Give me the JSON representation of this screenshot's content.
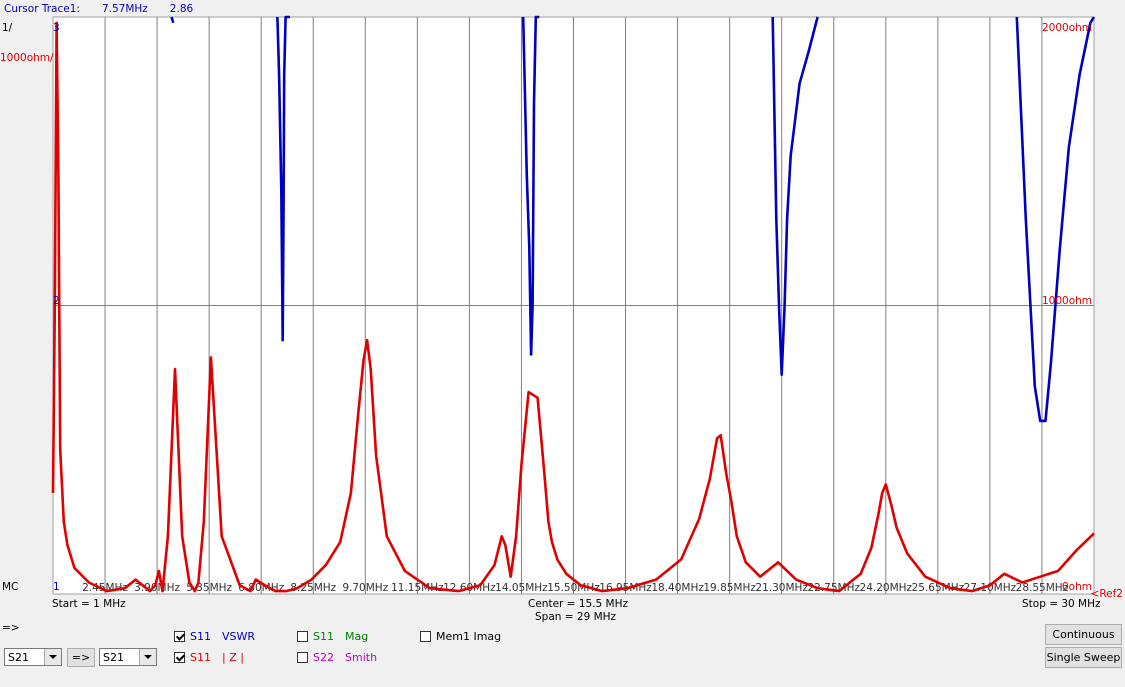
{
  "cursor": {
    "label": "Cursor Trace1:",
    "freq": "7.57MHz",
    "value": "2.86"
  },
  "left_axis": {
    "scale_unit": "1/",
    "scale_ohm": "1000ohm/",
    "top": "3",
    "mid": "2",
    "bottom": "1",
    "mc": "MC"
  },
  "right_axis": {
    "top": "2000ohm",
    "mid": "1000ohm",
    "bottom": "0ohm",
    "ref": "<Ref2"
  },
  "footer": {
    "start": "Start = 1 MHz",
    "center": "Center = 15.5 MHz",
    "span": "Span = 29 MHz",
    "stop": "Stop = 30 MHz",
    "arrow": "=>"
  },
  "controls": {
    "sel1": "S21",
    "transfer": "=>",
    "sel2": "S21",
    "continuous": "Continuous",
    "single_sweep": "Single Sweep",
    "legend": [
      {
        "param": "S11",
        "fmt": "VSWR",
        "checked": true,
        "color": "#0000c0"
      },
      {
        "param": "S11",
        "fmt": "| Z |",
        "checked": true,
        "color": "#e00000"
      },
      {
        "param": "S11",
        "fmt": "Mag",
        "checked": false,
        "color": "#008000"
      },
      {
        "param": "S22",
        "fmt": "Smith",
        "checked": false,
        "color": "#c000c0"
      },
      {
        "param": "",
        "fmt": "Mem1 Imag",
        "checked": false,
        "color": "#000000"
      }
    ]
  },
  "chart_data": {
    "type": "line",
    "x_ticks": [
      "2.45MHz",
      "3.90MHz",
      "5.35MHz",
      "6.80MHz",
      "8.25MHz",
      "9.70MHz",
      "11.15MHz",
      "12.60MHz",
      "14.05MHz",
      "15.50MHz",
      "16.95MHz",
      "18.40MHz",
      "19.85MHz",
      "21.30MHz",
      "22.75MHz",
      "24.20MHz",
      "25.65MHz",
      "27.10MHz",
      "28.55MHz"
    ],
    "xlim": [
      1,
      30
    ],
    "series": [
      {
        "name": "S11 VSWR",
        "color": "#0000c0",
        "axis": "left",
        "ylim": [
          1,
          3
        ],
        "x": [
          4.3,
          4.35,
          7.25,
          7.3,
          7.36,
          7.4,
          7.42,
          7.44,
          7.48,
          7.54,
          7.6,
          14.1,
          14.2,
          14.27,
          14.32,
          14.36,
          14.4,
          14.45,
          14.55,
          21.05,
          21.15,
          21.23,
          21.3,
          21.38,
          21.45,
          21.55,
          21.65,
          21.8,
          22.05,
          22.3,
          27.85,
          28.1,
          28.35,
          28.5,
          28.65,
          28.8,
          29.05,
          29.3,
          29.6,
          29.9,
          30.0
        ],
        "y": [
          3.0,
          2.98,
          3.0,
          2.8,
          2.4,
          1.88,
          2.3,
          2.8,
          3.0,
          3.0,
          3.0,
          3.0,
          2.45,
          2.2,
          1.83,
          2.0,
          2.7,
          3.0,
          3.0,
          3.0,
          2.3,
          1.98,
          1.76,
          2.0,
          2.3,
          2.52,
          2.62,
          2.77,
          2.88,
          3.0,
          3.0,
          2.3,
          1.72,
          1.6,
          1.6,
          1.8,
          2.2,
          2.55,
          2.8,
          2.98,
          3.0
        ]
      },
      {
        "name": "S11 |Z|",
        "color": "#e00000",
        "axis": "right",
        "ylim": [
          0,
          2000
        ],
        "x": [
          1.0,
          1.05,
          1.1,
          1.15,
          1.2,
          1.3,
          1.4,
          1.6,
          2.0,
          2.5,
          3.0,
          3.3,
          3.5,
          3.7,
          3.85,
          3.95,
          4.05,
          4.2,
          4.4,
          4.6,
          4.8,
          4.95,
          5.05,
          5.2,
          5.4,
          5.7,
          6.2,
          6.5,
          6.65,
          6.9,
          7.2,
          7.5,
          7.8,
          8.2,
          8.6,
          9.0,
          9.3,
          9.5,
          9.65,
          9.75,
          9.85,
          10.0,
          10.3,
          10.8,
          11.5,
          12.3,
          12.9,
          13.3,
          13.5,
          13.6,
          13.75,
          13.9,
          14.05,
          14.25,
          14.5,
          14.7,
          14.8,
          14.9,
          15.05,
          15.3,
          15.7,
          16.3,
          17.0,
          17.8,
          18.5,
          19.0,
          19.3,
          19.5,
          19.6,
          19.75,
          19.9,
          20.05,
          20.3,
          20.7,
          21.2,
          21.7,
          22.3,
          22.9,
          23.5,
          23.8,
          24.0,
          24.1,
          24.2,
          24.35,
          24.5,
          24.8,
          25.3,
          26.0,
          26.6,
          27.1,
          27.5,
          28.0,
          28.5,
          29.0,
          29.5,
          30.0
        ],
        "y": [
          350,
          1000,
          1980,
          1450,
          500,
          250,
          170,
          90,
          40,
          10,
          20,
          50,
          30,
          10,
          30,
          80,
          10,
          200,
          780,
          200,
          40,
          10,
          40,
          250,
          820,
          200,
          30,
          10,
          50,
          30,
          10,
          10,
          20,
          50,
          100,
          180,
          350,
          620,
          810,
          880,
          780,
          480,
          200,
          80,
          20,
          10,
          30,
          100,
          200,
          170,
          60,
          200,
          450,
          700,
          680,
          400,
          250,
          180,
          120,
          70,
          30,
          10,
          20,
          50,
          120,
          260,
          400,
          540,
          550,
          420,
          320,
          200,
          110,
          60,
          110,
          50,
          20,
          10,
          70,
          160,
          280,
          350,
          380,
          310,
          230,
          140,
          60,
          20,
          10,
          30,
          70,
          40,
          60,
          80,
          150,
          210
        ]
      }
    ]
  }
}
